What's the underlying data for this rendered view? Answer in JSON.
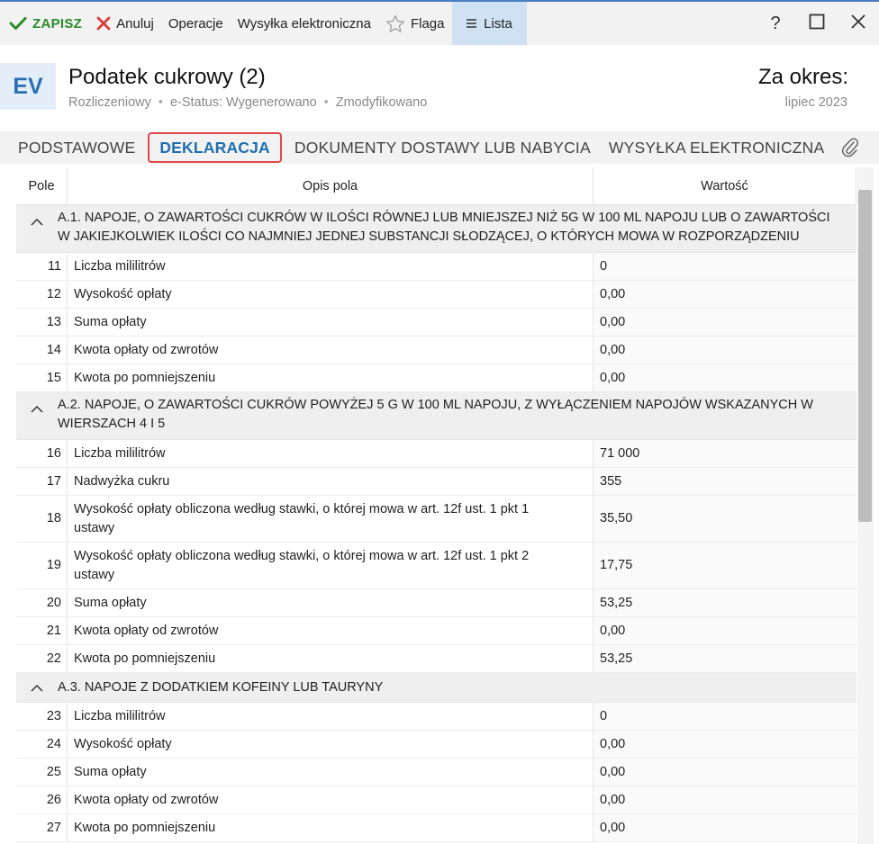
{
  "toolbar": {
    "save": "ZAPISZ",
    "cancel": "Anuluj",
    "operations": "Operacje",
    "e_send": "Wysyłka elektroniczna",
    "flag": "Flaga",
    "list": "Lista",
    "help": "?"
  },
  "header": {
    "badge": "EV",
    "title": "Podatek cukrowy (2)",
    "meta": [
      "Rozliczeniowy",
      "e-Status: Wygenerowano",
      "Zmodyfikowano"
    ],
    "period_label": "Za okres:",
    "period_value": "lipiec 2023"
  },
  "tabs": [
    "PODSTAWOWE",
    "DEKLARACJA",
    "DOKUMENTY DOSTAWY LUB NABYCIA",
    "WYSYŁKA ELEKTRONICZNA"
  ],
  "active_tab": "DEKLARACJA",
  "grid": {
    "columns": [
      "Pole",
      "Opis pola",
      "Wartość"
    ],
    "groups": [
      {
        "title": "A.1. NAPOJE, O ZAWARTOŚCI CUKRÓW W ILOŚCI RÓWNEJ LUB MNIEJSZEJ NIŻ 5G W 100 ML NAPOJU LUB O ZAWARTOŚCI W JAKIEJKOLWIEK ILOŚCI CO NAJMNIEJ JEDNEJ SUBSTANCJI SŁODZĄCEJ, O KTÓRYCH MOWA W ROZPORZĄDZENIU",
        "rows": [
          {
            "pole": "11",
            "opis": "Liczba mililitrów",
            "wartosc": "0"
          },
          {
            "pole": "12",
            "opis": "Wysokość opłaty",
            "wartosc": "0,00"
          },
          {
            "pole": "13",
            "opis": "Suma opłaty",
            "wartosc": "0,00"
          },
          {
            "pole": "14",
            "opis": "Kwota opłaty od zwrotów",
            "wartosc": "0,00"
          },
          {
            "pole": "15",
            "opis": "Kwota po pomniejszeniu",
            "wartosc": "0,00"
          }
        ]
      },
      {
        "title": "A.2. NAPOJE, O ZAWARTOŚCI CUKRÓW POWYŻEJ 5 G W 100 ML NAPOJU, Z WYŁĄCZENIEM NAPOJÓW WSKAZANYCH W WIERSZACH 4 I 5",
        "rows": [
          {
            "pole": "16",
            "opis": "Liczba mililitrów",
            "wartosc": "71 000"
          },
          {
            "pole": "17",
            "opis": "Nadwyżka cukru",
            "wartosc": "355"
          },
          {
            "pole": "18",
            "opis": "Wysokość opłaty obliczona według stawki, o której mowa w art. 12f ust. 1 pkt 1 ustawy",
            "wartosc": "35,50"
          },
          {
            "pole": "19",
            "opis": "Wysokość opłaty obliczona według stawki, o której mowa w art. 12f ust. 1 pkt 2 ustawy",
            "wartosc": "17,75"
          },
          {
            "pole": "20",
            "opis": "Suma opłaty",
            "wartosc": "53,25"
          },
          {
            "pole": "21",
            "opis": "Kwota opłaty od zwrotów",
            "wartosc": "0,00"
          },
          {
            "pole": "22",
            "opis": "Kwota po pomniejszeniu",
            "wartosc": "53,25"
          }
        ]
      },
      {
        "title": "A.3. NAPOJE Z DODATKIEM KOFEINY LUB TAURYNY",
        "rows": [
          {
            "pole": "23",
            "opis": "Liczba mililitrów",
            "wartosc": "0"
          },
          {
            "pole": "24",
            "opis": "Wysokość opłaty",
            "wartosc": "0,00"
          },
          {
            "pole": "25",
            "opis": "Suma opłaty",
            "wartosc": "0,00"
          },
          {
            "pole": "26",
            "opis": "Kwota opłaty od zwrotów",
            "wartosc": "0,00"
          },
          {
            "pole": "27",
            "opis": "Kwota po pomniejszeniu",
            "wartosc": "0,00"
          }
        ]
      }
    ]
  },
  "icons": {
    "save": "check-icon",
    "cancel": "close-x-icon",
    "flag": "star-icon",
    "list": "list-lines-icon",
    "attach": "paperclip-icon"
  },
  "colors": {
    "save_green": "#2a8a2a",
    "cancel_red": "#d93a3a",
    "accent_blue": "#1f6fb0",
    "active_tab_border": "#e0474c"
  }
}
